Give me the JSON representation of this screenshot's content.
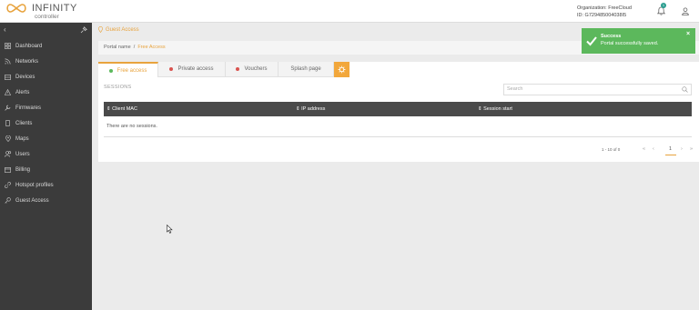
{
  "header": {
    "logo_name": "INFINITY",
    "logo_sub": "controller",
    "org_line": "Organization: FreeCloud",
    "id_line": "ID: G729485004038I5",
    "notification_count": "1"
  },
  "sidebar": {
    "items": [
      {
        "label": "Dashboard",
        "icon": "dashboard-icon"
      },
      {
        "label": "Networks",
        "icon": "wifi-icon"
      },
      {
        "label": "Devices",
        "icon": "device-icon"
      },
      {
        "label": "Alerts",
        "icon": "alert-icon"
      },
      {
        "label": "Firmwares",
        "icon": "wrench-icon"
      },
      {
        "label": "Clients",
        "icon": "phone-icon"
      },
      {
        "label": "Maps",
        "icon": "map-pin-icon"
      },
      {
        "label": "Users",
        "icon": "users-icon"
      },
      {
        "label": "Billing",
        "icon": "billing-icon"
      },
      {
        "label": "Hotspot profiles",
        "icon": "link-icon"
      },
      {
        "label": "Guest Access",
        "icon": "key-icon"
      }
    ]
  },
  "breadcrumb": {
    "top": "Guest Access",
    "portal": "Portal name",
    "separator": "/",
    "current": "Free Access"
  },
  "tabs": [
    {
      "label": "Free access",
      "dot": "#5cb85c",
      "active": true
    },
    {
      "label": "Private access",
      "dot": "#d9534f",
      "active": false
    },
    {
      "label": "Vouchers",
      "dot": "#d9534f",
      "active": false
    },
    {
      "label": "Splash page",
      "dot": "",
      "active": false
    }
  ],
  "sessions": {
    "label": "SESSIONS",
    "search_placeholder": "Search",
    "columns": [
      "⇕ Client MAC",
      "⇕ IP address",
      "⇕ Session start"
    ],
    "empty_text": "There are no sessions.",
    "pager_info": "1 - 10 of 0",
    "pager_first": "«",
    "pager_prev": "‹",
    "pager_page": "1",
    "pager_next": "›",
    "pager_last": "»"
  },
  "toast": {
    "title": "Success",
    "message": "Portal successfully saved.",
    "close": "×"
  },
  "colors": {
    "accent": "#e8a33d",
    "sidebar": "#3b3b3b",
    "success": "#5cb85c"
  }
}
